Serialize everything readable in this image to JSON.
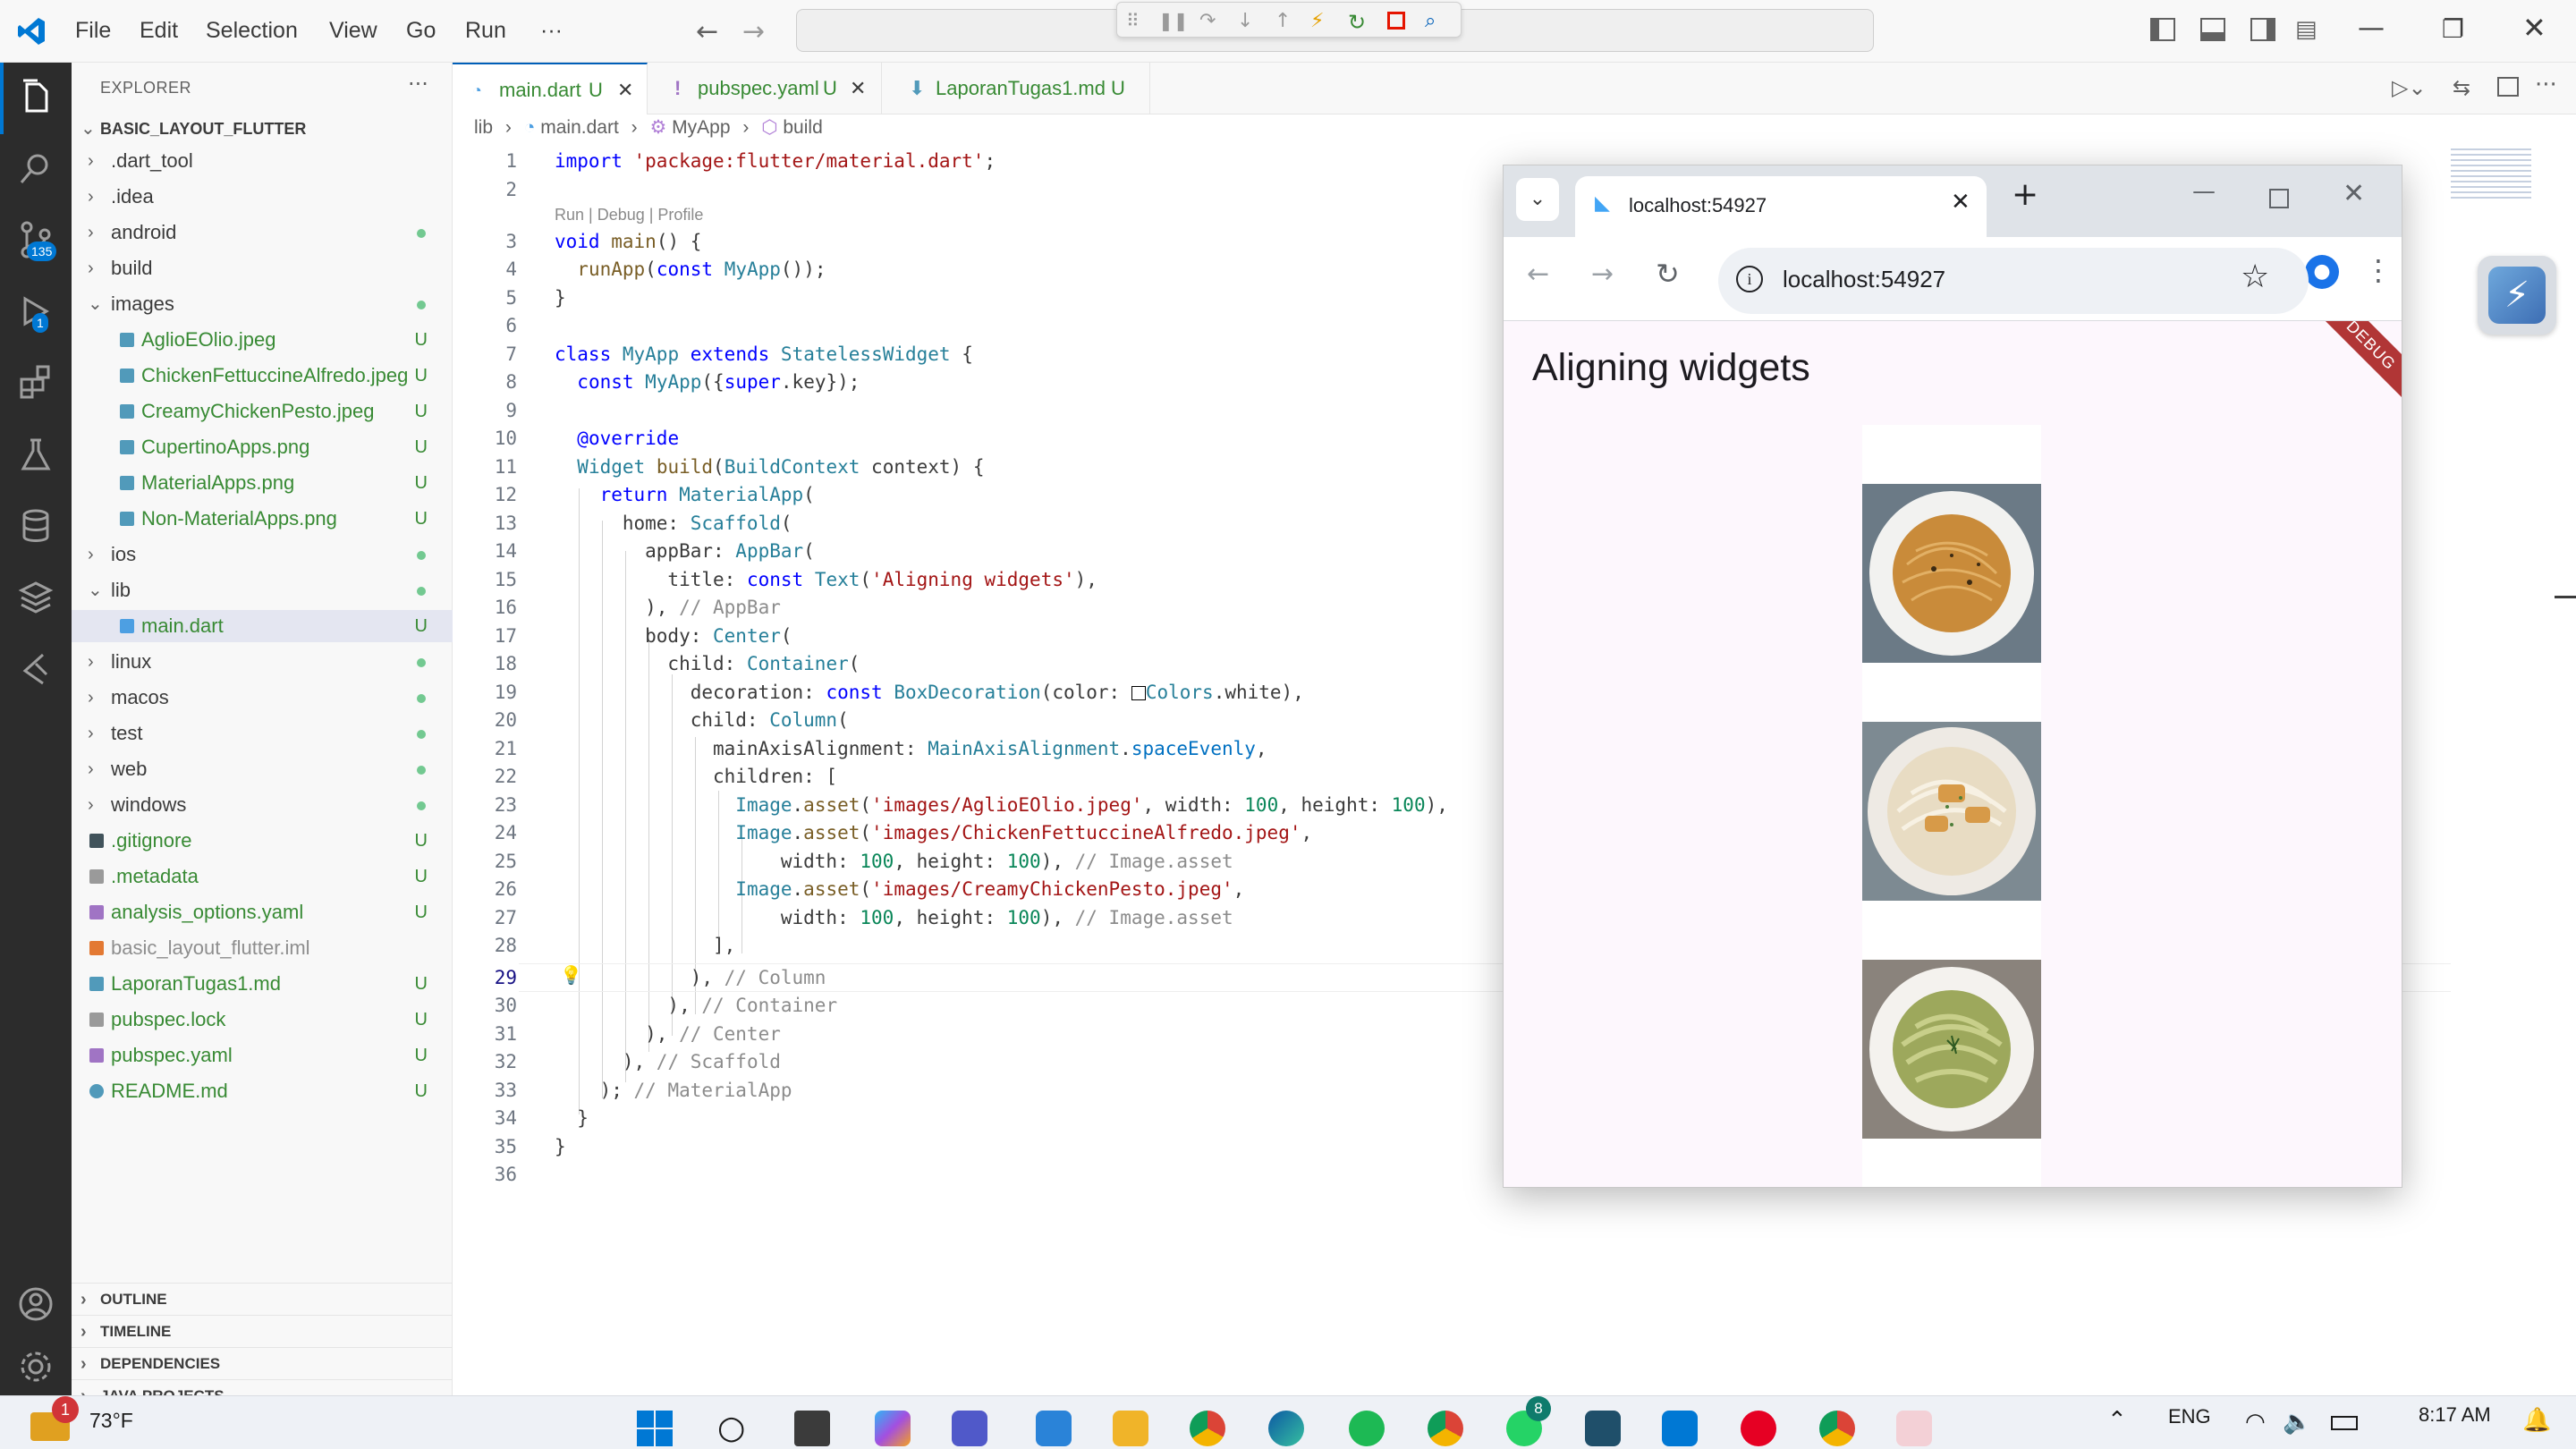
{
  "menu": [
    "File",
    "Edit",
    "Selection",
    "View",
    "Go",
    "Run"
  ],
  "menu_more": "···",
  "activity": {
    "source_control_badge": "135",
    "debug_badge": "1"
  },
  "explorer": {
    "title": "EXPLORER",
    "more": "···",
    "root": "BASIC_LAYOUT_FLUTTER",
    "items": [
      {
        "label": ".dart_tool",
        "kind": "folder"
      },
      {
        "label": ".idea",
        "kind": "folder"
      },
      {
        "label": "android",
        "kind": "folder",
        "status": "dot"
      },
      {
        "label": "build",
        "kind": "folder"
      },
      {
        "label": "images",
        "kind": "folder-open",
        "status": "dot"
      },
      {
        "label": "AglioEOlio.jpeg",
        "kind": "image",
        "status": "U"
      },
      {
        "label": "ChickenFettuccineAlfredo.jpeg",
        "kind": "image",
        "status": "U"
      },
      {
        "label": "CreamyChickenPesto.jpeg",
        "kind": "image",
        "status": "U"
      },
      {
        "label": "CupertinoApps.png",
        "kind": "image",
        "status": "U"
      },
      {
        "label": "MaterialApps.png",
        "kind": "image",
        "status": "U"
      },
      {
        "label": "Non-MaterialApps.png",
        "kind": "image",
        "status": "U"
      },
      {
        "label": "ios",
        "kind": "folder",
        "status": "dot"
      },
      {
        "label": "lib",
        "kind": "folder-open",
        "status": "dot"
      },
      {
        "label": "main.dart",
        "kind": "dart",
        "status": "U",
        "selected": true
      },
      {
        "label": "linux",
        "kind": "folder",
        "status": "dot"
      },
      {
        "label": "macos",
        "kind": "folder",
        "status": "dot"
      },
      {
        "label": "test",
        "kind": "folder",
        "status": "dot"
      },
      {
        "label": "web",
        "kind": "folder",
        "status": "dot"
      },
      {
        "label": "windows",
        "kind": "folder",
        "status": "dot"
      },
      {
        "label": ".gitignore",
        "kind": "git",
        "status": "U"
      },
      {
        "label": ".metadata",
        "kind": "file",
        "status": "U"
      },
      {
        "label": "analysis_options.yaml",
        "kind": "yaml",
        "status": "U"
      },
      {
        "label": "basic_layout_flutter.iml",
        "kind": "iml"
      },
      {
        "label": "LaporanTugas1.md",
        "kind": "md",
        "status": "U"
      },
      {
        "label": "pubspec.lock",
        "kind": "file",
        "status": "U"
      },
      {
        "label": "pubspec.yaml",
        "kind": "yaml",
        "status": "U"
      },
      {
        "label": "README.md",
        "kind": "info",
        "status": "U"
      }
    ],
    "panels": [
      "OUTLINE",
      "TIMELINE",
      "DEPENDENCIES",
      "JAVA PROJECTS"
    ]
  },
  "tabs": [
    {
      "label": "main.dart",
      "status": "U",
      "active": true
    },
    {
      "label": "pubspec.yaml",
      "status": "U"
    },
    {
      "label": "LaporanTugas1.md",
      "status": "U"
    }
  ],
  "breadcrumb": [
    "lib",
    "main.dart",
    "MyApp",
    "build"
  ],
  "codelens": "Run | Debug | Profile",
  "browser": {
    "tab_title": "localhost:54927",
    "url": "localhost:54927",
    "new_tab": "+",
    "app_title": "Aligning widgets",
    "debug_banner": "DEBUG"
  },
  "taskbar": {
    "weather": "73°F",
    "weather_badge": "1",
    "whatsapp_badge": "8",
    "lang": "ENG",
    "time": "8:17 AM"
  },
  "colors": {
    "accent": "#005fb8",
    "untracked_green": "#388a34",
    "activity_bg": "#2c2c2c",
    "debug_banner": "#b13636"
  }
}
